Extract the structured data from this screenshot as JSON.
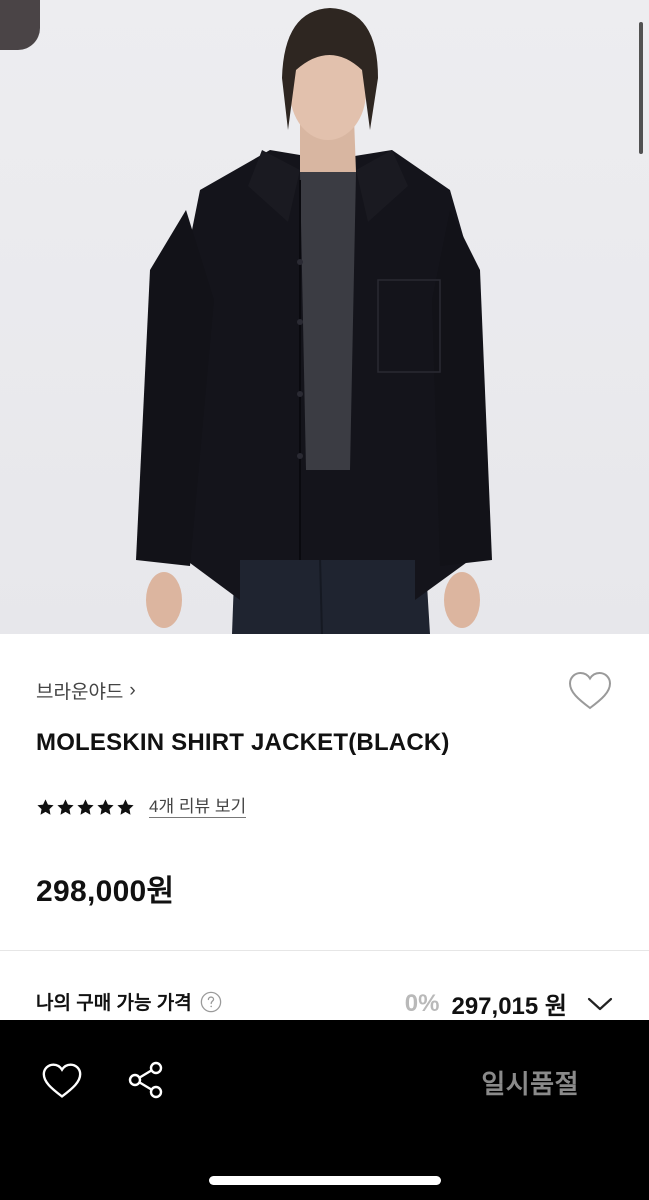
{
  "brand": {
    "name": "브라운야드",
    "chevron": "›"
  },
  "product": {
    "title": "MOLESKIN SHIRT JACKET(BLACK)",
    "rating_stars": 5,
    "review_link": "4개 리뷰 보기",
    "price": "298,000원"
  },
  "purchase": {
    "label": "나의 구매 가능 가격",
    "discount": "0%",
    "price": "297,015 원"
  },
  "bottom_bar": {
    "status": "일시품절"
  },
  "icons": {
    "wishlist": "heart-outline-icon",
    "share": "share-icon",
    "help": "question-circle-icon",
    "expand": "chevron-down-icon",
    "rating": "star-icon"
  },
  "colors": {
    "bottom_bar_bg": "#000000",
    "discount_gray": "#b9b9b9",
    "soldout_gray": "#8a8a8a"
  }
}
